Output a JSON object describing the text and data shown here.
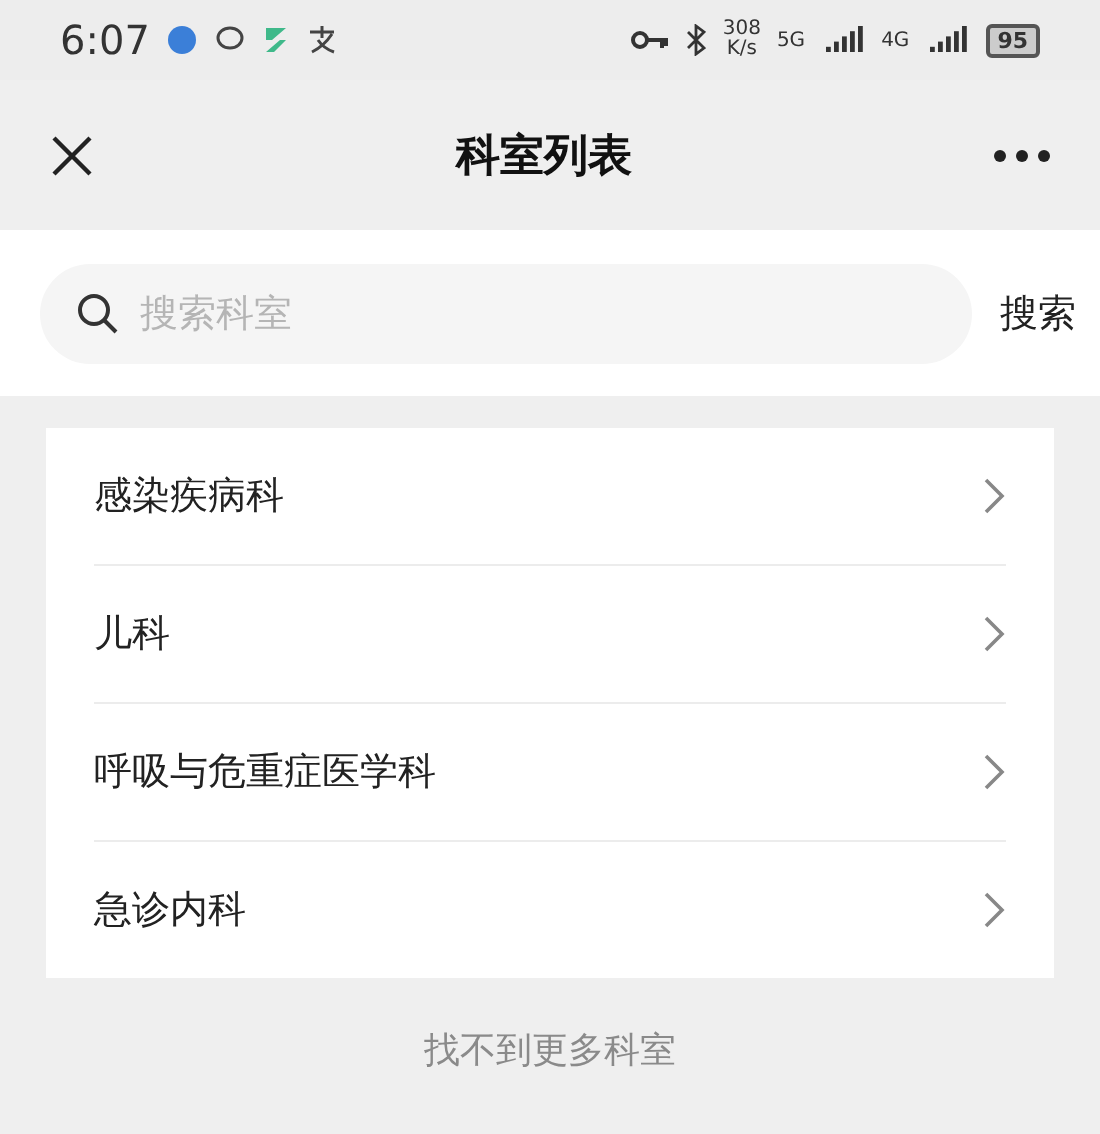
{
  "status_bar": {
    "time": "6:07",
    "speed": "308",
    "speed_unit": "K/s",
    "network_1": "5G",
    "network_2": "4G",
    "battery": "95"
  },
  "header": {
    "title": "科室列表"
  },
  "search": {
    "placeholder": "搜索科室",
    "button": "搜索"
  },
  "departments": [
    {
      "name": "感染疾病科"
    },
    {
      "name": "儿科"
    },
    {
      "name": "呼吸与危重症医学科"
    },
    {
      "name": "急诊内科"
    }
  ],
  "footer": "找不到更多科室"
}
